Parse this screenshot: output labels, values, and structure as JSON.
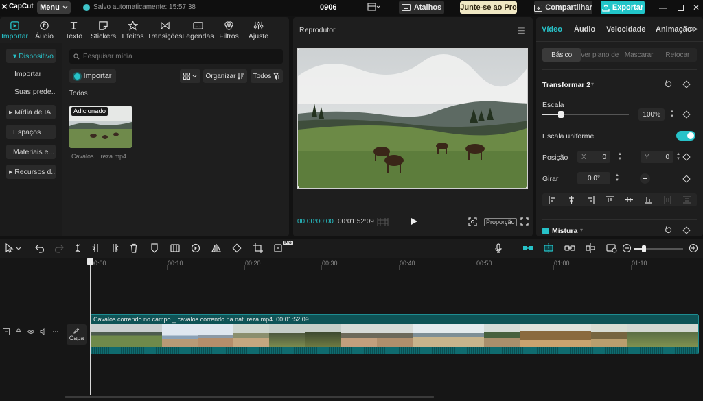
{
  "titlebar": {
    "logo_text": "CapCut",
    "menu_label": "Menu",
    "autosave_text": "Salvo automaticamente: 15:57:38",
    "project_title": "0906",
    "shortcuts_label": "Atalhos",
    "pro_label": "Junte-se ao Pro",
    "share_label": "Compartilhar",
    "export_label": "Exportar"
  },
  "media_tabs": [
    {
      "label": "Importar",
      "icon": "import-icon"
    },
    {
      "label": "Áudio",
      "icon": "audio-icon"
    },
    {
      "label": "Texto",
      "icon": "text-icon"
    },
    {
      "label": "Stickers",
      "icon": "sticker-icon"
    },
    {
      "label": "Efeitos",
      "icon": "effects-icon"
    },
    {
      "label": "Transições",
      "icon": "transitions-icon"
    },
    {
      "label": "Legendas",
      "icon": "captions-icon"
    },
    {
      "label": "Filtros",
      "icon": "filters-icon"
    },
    {
      "label": "Ajuste",
      "icon": "adjust-icon"
    }
  ],
  "left_nav": [
    {
      "label": "Dispositivo"
    },
    {
      "label": "Importar"
    },
    {
      "label": "Suas prede..."
    },
    {
      "label": "Mídia de IA"
    },
    {
      "label": "Espaços"
    },
    {
      "label": "Materiais e..."
    },
    {
      "label": "Recursos d..."
    }
  ],
  "media": {
    "search_placeholder": "Pesquisar mídia",
    "import_label": "Importar",
    "sort_label": "Organizar",
    "filter_label": "Todos",
    "section_label": "Todos",
    "item_badge": "Adicionado",
    "item_caption": "Cavalos ...reza.mp4"
  },
  "player": {
    "title": "Reprodutor",
    "time_current": "00:00:00:00",
    "time_total": "00:01:52:09",
    "ratio_label": "Proporção"
  },
  "inspector": {
    "tabs": [
      "Vídeo",
      "Áudio",
      "Velocidade",
      "Animação"
    ],
    "subtabs": [
      "Básico",
      "Remover plano de fundo",
      "Mascarar",
      "Retocar"
    ],
    "transform_title": "Transformar 2",
    "scale_label": "Escala",
    "scale_value": "100%",
    "scale_slider_fraction": 0.17,
    "uniform_scale_label": "Escala uniforme",
    "uniform_scale_on": true,
    "position_label": "Posição",
    "pos_x_key": "X",
    "pos_x_value": "0",
    "pos_y_key": "Y",
    "pos_y_value": "0",
    "rotate_label": "Girar",
    "rotate_value": "0.0°",
    "blend_label": "Mistura"
  },
  "timeline": {
    "ruler_labels": [
      "00:00",
      "00:10",
      "00:20",
      "00:30",
      "00:40",
      "00:50",
      "01:00",
      "01:10"
    ],
    "cover_label": "Capa",
    "clip_name": "Cavalos correndo no campo _ cavalos correndo na natureza.mp4",
    "clip_duration": "00:01:52:09"
  },
  "colors": {
    "accent": "#27c2c8",
    "export_bg": "#21c5c9",
    "pro_bg": "#f0e8c4"
  }
}
